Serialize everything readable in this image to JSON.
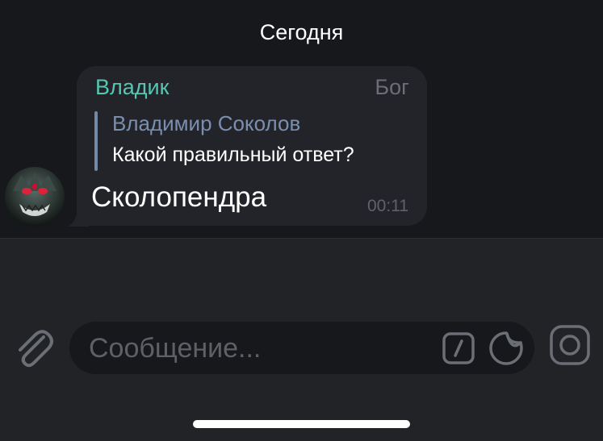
{
  "chat": {
    "date_label": "Сегодня",
    "message": {
      "sender_name": "Владик",
      "sender_title": "Бог",
      "reply": {
        "author": "Владимир Соколов",
        "text": "Какой правильный ответ?"
      },
      "text": "Сколопендра",
      "time": "00:11"
    }
  },
  "composer": {
    "placeholder": "Сообщение...",
    "icons": {
      "attach": "paperclip-icon",
      "commands": "slash-command-icon",
      "sticker": "sticker-icon",
      "video_note": "camera-circle-icon"
    }
  },
  "colors": {
    "background": "#17181c",
    "bubble": "#232429",
    "input_panel": "#222327",
    "sender_name": "#55c7b1",
    "reply_author": "#7a8fb0",
    "muted_text": "#5f626a"
  }
}
